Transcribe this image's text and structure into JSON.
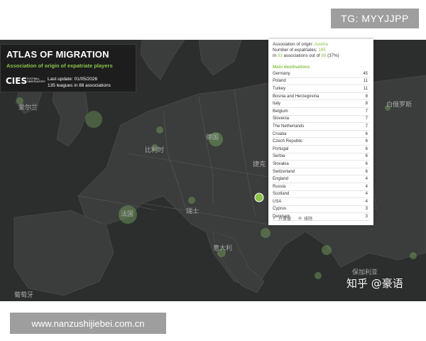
{
  "tags": {
    "top_right": "TG: MYYJJPP",
    "bottom_url": "www.nanzushijiebei.com.cn"
  },
  "header": {
    "title": "ATLAS OF MIGRATION",
    "subtitle": "Association of origin of expatriate players",
    "logo_text": "CIES",
    "logo_small": "FOOTBALL OBSERVATORY",
    "last_update": "Last update: 01/05/2026",
    "leagues": "135 leagues in 88 associations"
  },
  "popup": {
    "origin_label": "Association of origin:",
    "origin_value": "Austria",
    "expat_label": "Number of expatriates:",
    "expat_value": "185",
    "in_prefix": "In",
    "in_count": "33",
    "in_middle": "associations out of",
    "in_total": "88",
    "in_pct": "(37%)",
    "section_title": "Main destinations",
    "destinations": [
      {
        "name": "Germany",
        "count": "45"
      },
      {
        "name": "Poland",
        "count": "11"
      },
      {
        "name": "Turkey",
        "count": "11"
      },
      {
        "name": "Bosnia and Herzegovina",
        "count": "8"
      },
      {
        "name": "Italy",
        "count": "8"
      },
      {
        "name": "Belgium",
        "count": "7"
      },
      {
        "name": "Slovenia",
        "count": "7"
      },
      {
        "name": "The Netherlands",
        "count": "7"
      },
      {
        "name": "Croatia",
        "count": "6"
      },
      {
        "name": "Czech Republic",
        "count": "6"
      },
      {
        "name": "Portugal",
        "count": "6"
      },
      {
        "name": "Serbia",
        "count": "6"
      },
      {
        "name": "Slovakia",
        "count": "6"
      },
      {
        "name": "Switzerland",
        "count": "6"
      },
      {
        "name": "England",
        "count": "4"
      },
      {
        "name": "Russia",
        "count": "4"
      },
      {
        "name": "Scotland",
        "count": "4"
      },
      {
        "name": "USA",
        "count": "4"
      },
      {
        "name": "Cyprus",
        "count": "3"
      },
      {
        "name": "Denmark",
        "count": "3"
      }
    ],
    "keep_only": "只保留",
    "exclude": "排除"
  },
  "map_labels": {
    "ireland": "爱尔兰",
    "belarus": "白俄罗斯",
    "germany": "德国",
    "belgium": "比利时",
    "czech": "捷克",
    "france": "法国",
    "switzerland": "瑞士",
    "italy": "意大利",
    "bulgaria": "保加利亚",
    "portugal": "葡萄牙"
  },
  "watermark": "知乎 @豪语",
  "colors": {
    "map_bg": "#2c2e2d",
    "land": "#3b3d3c",
    "bubble": "#6f9a5a",
    "accent": "#8bc34a"
  },
  "bubbles": [
    {
      "name": "Austria",
      "selected": true
    },
    {
      "name": "Germany"
    },
    {
      "name": "Poland"
    },
    {
      "name": "Turkey"
    },
    {
      "name": "Italy"
    },
    {
      "name": "France"
    },
    {
      "name": "Belgium"
    },
    {
      "name": "Ireland"
    },
    {
      "name": "Croatia"
    }
  ]
}
